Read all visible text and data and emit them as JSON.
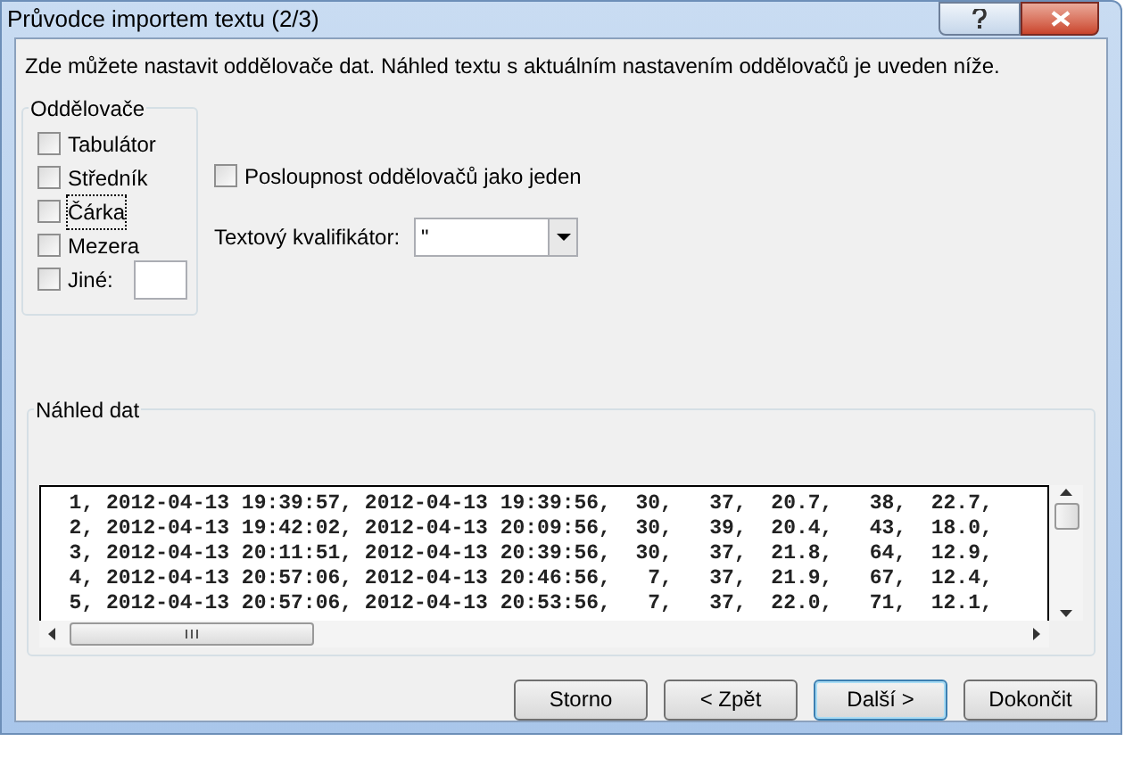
{
  "window": {
    "title": "Průvodce importem textu (2/3)"
  },
  "instruction": "Zde můžete nastavit oddělovače dat. Náhled textu s aktuálním nastavením oddělovačů je uveden níže.",
  "separators": {
    "title": "Oddělovače",
    "items": [
      {
        "label": "Tabulátor",
        "checked": false,
        "focused": false
      },
      {
        "label": "Středník",
        "checked": false,
        "focused": false
      },
      {
        "label": "Čárka",
        "checked": false,
        "focused": true
      },
      {
        "label": "Mezera",
        "checked": false,
        "focused": false
      },
      {
        "label": "Jiné:",
        "checked": false,
        "focused": false
      }
    ]
  },
  "consecutive": {
    "label": "Posloupnost oddělovačů jako jeden",
    "checked": false
  },
  "qualifier": {
    "label": "Textový kvalifikátor:",
    "value": "\""
  },
  "preview": {
    "title": "Náhled dat",
    "rows": [
      "  1, 2012-04-13 19:39:57, 2012-04-13 19:39:56,  30,   37,  20.7,   38,  22.7,",
      "  2, 2012-04-13 19:42:02, 2012-04-13 20:09:56,  30,   39,  20.4,   43,  18.0,",
      "  3, 2012-04-13 20:11:51, 2012-04-13 20:39:56,  30,   37,  21.8,   64,  12.9,",
      "  4, 2012-04-13 20:57:06, 2012-04-13 20:46:56,   7,   37,  21.9,   67,  12.4,",
      "  5, 2012-04-13 20:57:06, 2012-04-13 20:53:56,   7,   37,  22.0,   71,  12.1,"
    ]
  },
  "buttons": [
    {
      "label": "Storno",
      "default": false
    },
    {
      "label": "< Zpět",
      "default": false
    },
    {
      "label": "Další >",
      "default": true
    },
    {
      "label": "Dokončit",
      "default": false
    }
  ]
}
